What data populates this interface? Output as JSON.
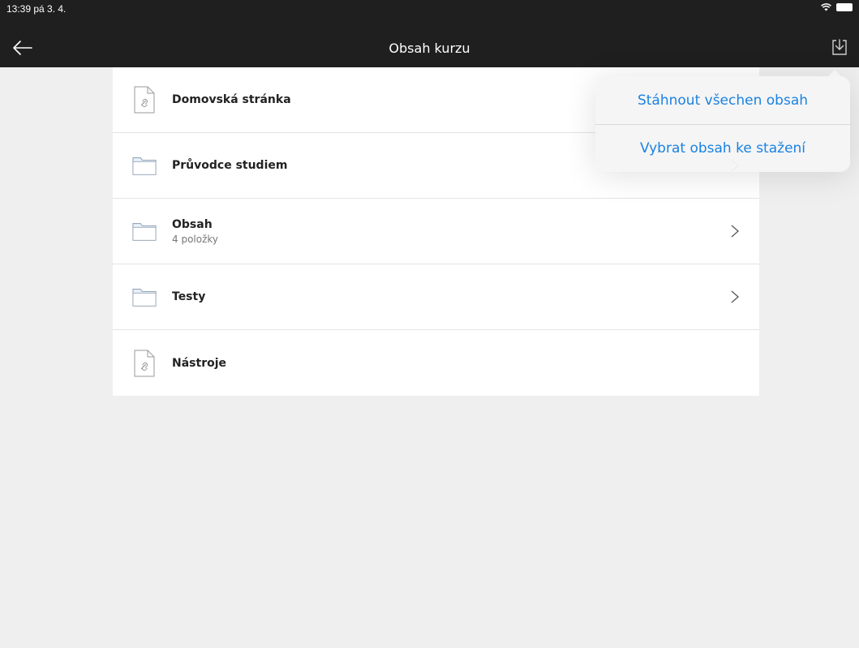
{
  "status": {
    "time": "13:39  pá 3. 4."
  },
  "nav": {
    "title": "Obsah kurzu"
  },
  "items": [
    {
      "title": "Domovská stránka",
      "subtitle": "",
      "icon": "link-document-icon",
      "has_chevron": false
    },
    {
      "title": "Průvodce studiem",
      "subtitle": "",
      "icon": "folder-icon",
      "has_chevron": true
    },
    {
      "title": "Obsah",
      "subtitle": "4 položky",
      "icon": "folder-icon",
      "has_chevron": true
    },
    {
      "title": "Testy",
      "subtitle": "",
      "icon": "folder-icon",
      "has_chevron": true
    },
    {
      "title": "Nástroje",
      "subtitle": "",
      "icon": "link-document-icon",
      "has_chevron": false
    }
  ],
  "popover": {
    "download_all": "Stáhnout všechen obsah",
    "select_download": "Vybrat obsah ke stažení"
  },
  "colors": {
    "accent": "#1a82e2",
    "bar": "#1f1f1f",
    "background": "#efefef"
  }
}
